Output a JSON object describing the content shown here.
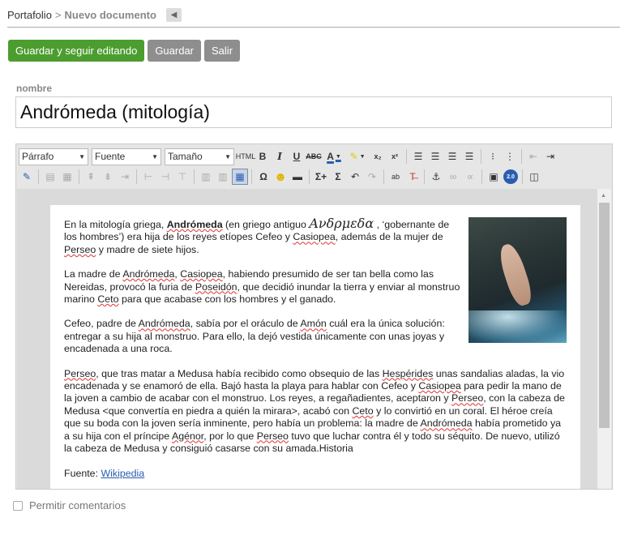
{
  "breadcrumb": {
    "root": "Portafolio",
    "separator": ">",
    "current": "Nuevo documento"
  },
  "actions": {
    "save_continue": "Guardar y seguir editando",
    "save": "Guardar",
    "exit": "Salir"
  },
  "colors": {
    "primary": "#4c9d2f",
    "grey_button": "#8e8e8e",
    "link": "#2a5db0"
  },
  "form": {
    "name_label": "nombre",
    "name_value": "Andrómeda (mitología)",
    "allow_comments_label": "Permitir comentarios",
    "allow_comments_checked": false
  },
  "toolbar": {
    "format_select": "Párrafo",
    "font_select": "Fuente",
    "size_select": "Tamaño",
    "html_label": "HTML",
    "bold": "B",
    "italic": "I",
    "underline": "U",
    "strike": "ABC",
    "font_color": "A",
    "subscript": "x₂",
    "superscript": "x²",
    "omega": "Ω",
    "sigma_add": "Σ+",
    "sigma": "Σ",
    "badge": "2.0"
  },
  "content": {
    "p1": {
      "t1": "En la mitología griega, ",
      "andromeda_bold": "Andrómeda",
      "t2": " (en griego antiguo ",
      "greek": "Ανδρμεδα",
      "t3": " , ‘gobernante de los hombres’) era hija de los reyes etíopes Cefeo y ",
      "casiopea": "Casiopea",
      "t4": ", además de la mujer de ",
      "perseo": "Perseo",
      "t5": " y madre de siete hijos."
    },
    "p2": {
      "t1": "La madre de ",
      "andromeda": "Andrómeda",
      "t2": ", ",
      "casiopea": "Casiopea",
      "t3": ", habiendo presumido de ser tan bella como las Nereidas, provocó la furia de ",
      "poseidon": "Poseidón",
      "t4": ", que decidió inundar la tierra y enviar al monstruo marino ",
      "ceto": "Ceto",
      "t5": " para que acabase con los hombres y el ganado."
    },
    "p3": {
      "t1": "Cefeo, padre de ",
      "andromeda": "Andrómeda",
      "t2": ", sabía por el oráculo de ",
      "amon": "Amón",
      "t3": " cuál era la única solución: entregar a su hija al monstruo. Para ello, la dejó vestida únicamente con unas joyas y encadenada a una roca."
    },
    "p4": {
      "perseo1": "Perseo",
      "t1": ", que tras matar a Medusa había recibido como obsequio de las ",
      "hesperides": "Hespérides",
      "t2": " unas sandalias aladas, la vio encadenada y se enamoró de ella. Bajó hasta la playa para hablar con Cefeo y ",
      "casiopea": "Casiopea",
      "t3": " para pedir la mano de la joven a cambio de acabar con el monstruo. Los reyes, a regañadientes, aceptaron y ",
      "perseo2": "Perseo",
      "t4": ", con la cabeza de Medusa <que convertía en piedra a quién la mirara>, acabó con ",
      "ceto": "Ceto",
      "t5": " y lo convirtió en un coral. El héroe creía que su boda con la joven sería inminente, pero había un problema: la madre de ",
      "andromeda": "Andrómeda",
      "t6": " había prometido ya a su hija con el príncipe ",
      "agenor": "Agénor",
      "t7": ", por lo que ",
      "perseo3": "Perseo",
      "t8": " tuvo que luchar contra él y todo su séquito. De nuevo, utilizó la cabeza de Medusa y consiguió casarse con su amada.Historia"
    },
    "source": {
      "label": "Fuente: ",
      "link": "Wikipedia"
    }
  }
}
